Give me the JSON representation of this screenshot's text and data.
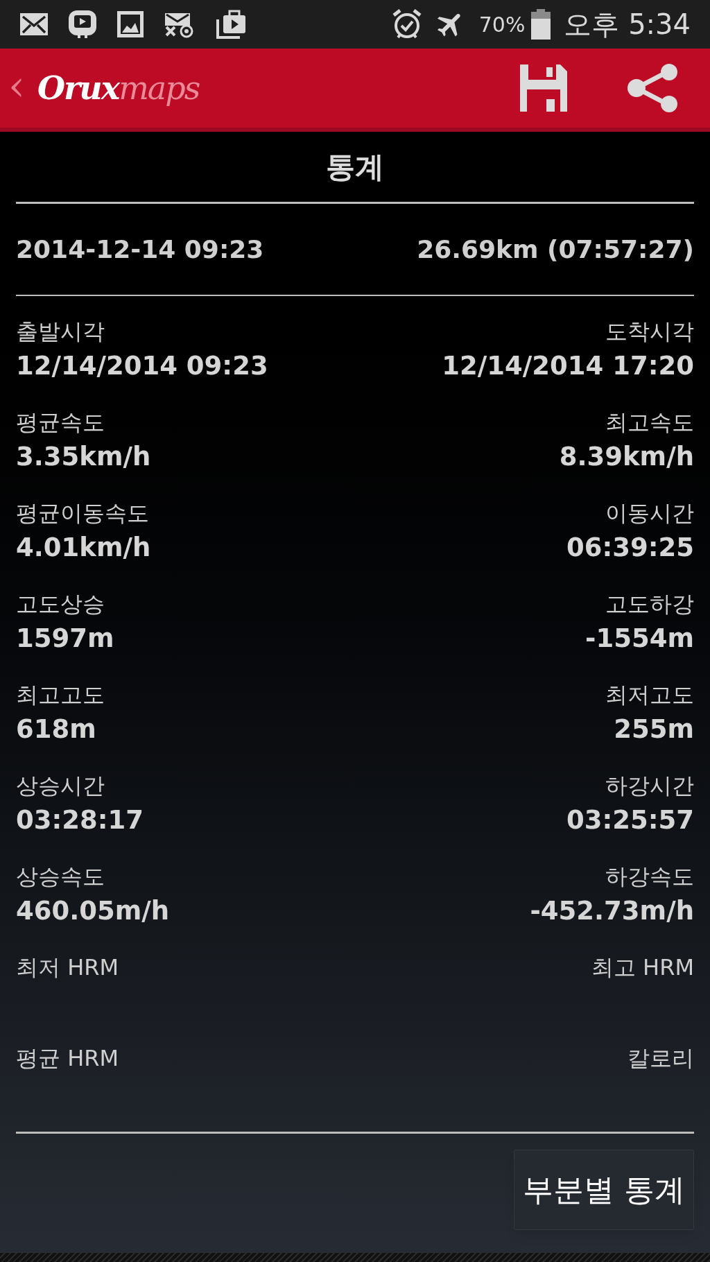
{
  "status_bar": {
    "battery": "70%",
    "time": "오후 5:34"
  },
  "app_bar": {
    "back": "‹",
    "logo_primary": "Orux",
    "logo_secondary": "maps"
  },
  "title": "통계",
  "summary": {
    "date": "2014-12-14 09:23",
    "distance": "26.69km (07:57:27)"
  },
  "stats": [
    {
      "left": {
        "label": "출발시각",
        "value": "12/14/2014 09:23"
      },
      "right": {
        "label": "도착시각",
        "value": "12/14/2014 17:20"
      }
    },
    {
      "left": {
        "label": "평균속도",
        "value": "3.35km/h"
      },
      "right": {
        "label": "최고속도",
        "value": "8.39km/h"
      }
    },
    {
      "left": {
        "label": "평균이동속도",
        "value": "4.01km/h"
      },
      "right": {
        "label": "이동시간",
        "value": "06:39:25"
      }
    },
    {
      "left": {
        "label": "고도상승",
        "value": "1597m"
      },
      "right": {
        "label": "고도하강",
        "value": "-1554m"
      }
    },
    {
      "left": {
        "label": "최고고도",
        "value": "618m"
      },
      "right": {
        "label": "최저고도",
        "value": "255m"
      }
    },
    {
      "left": {
        "label": "상승시간",
        "value": "03:28:17"
      },
      "right": {
        "label": "하강시간",
        "value": "03:25:57"
      }
    },
    {
      "left": {
        "label": "상승속도",
        "value": "460.05m/h"
      },
      "right": {
        "label": "하강속도",
        "value": "-452.73m/h"
      }
    },
    {
      "left": {
        "label": "최저 HRM"
      },
      "right": {
        "label": "최고 HRM"
      }
    },
    {
      "left": {
        "label": "평균 HRM"
      },
      "right": {
        "label": "칼로리"
      }
    }
  ],
  "segment_button": "부분별 통계"
}
